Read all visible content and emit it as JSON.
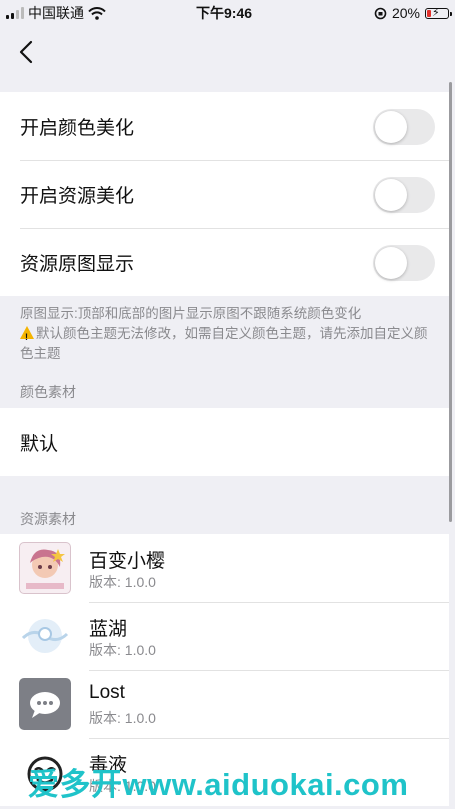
{
  "status": {
    "carrier": "中国联通",
    "time": "下午9:46",
    "battery": "20%",
    "battery_level": 0.2
  },
  "settings": {
    "rows": [
      {
        "label": "开启颜色美化",
        "enabled": false
      },
      {
        "label": "开启资源美化",
        "enabled": false
      },
      {
        "label": "资源原图显示",
        "enabled": false
      }
    ],
    "note_line1": "原图显示:顶部和底部的图片显示原图不跟随系统颜色变化",
    "note_line2": "默认颜色主题无法修改，如需自定义颜色主题，请先添加自定义颜色主题"
  },
  "color_section": {
    "header": "颜色素材",
    "default_label": "默认"
  },
  "resource_section": {
    "header": "资源素材",
    "items": [
      {
        "name": "百变小樱",
        "version": "版本: 1.0.0"
      },
      {
        "name": "蓝湖",
        "version": "版本: 1.0.0"
      },
      {
        "name": "Lost",
        "version": "版本: 1.0.0"
      },
      {
        "name": "毒液",
        "version": "版本: 1.0.0"
      }
    ]
  },
  "watermark": "爱多开www.aiduokai.com",
  "colors": {
    "toggle_off": "#e9e9ea",
    "background": "#efeff4",
    "watermark": "#1fc3c9"
  }
}
